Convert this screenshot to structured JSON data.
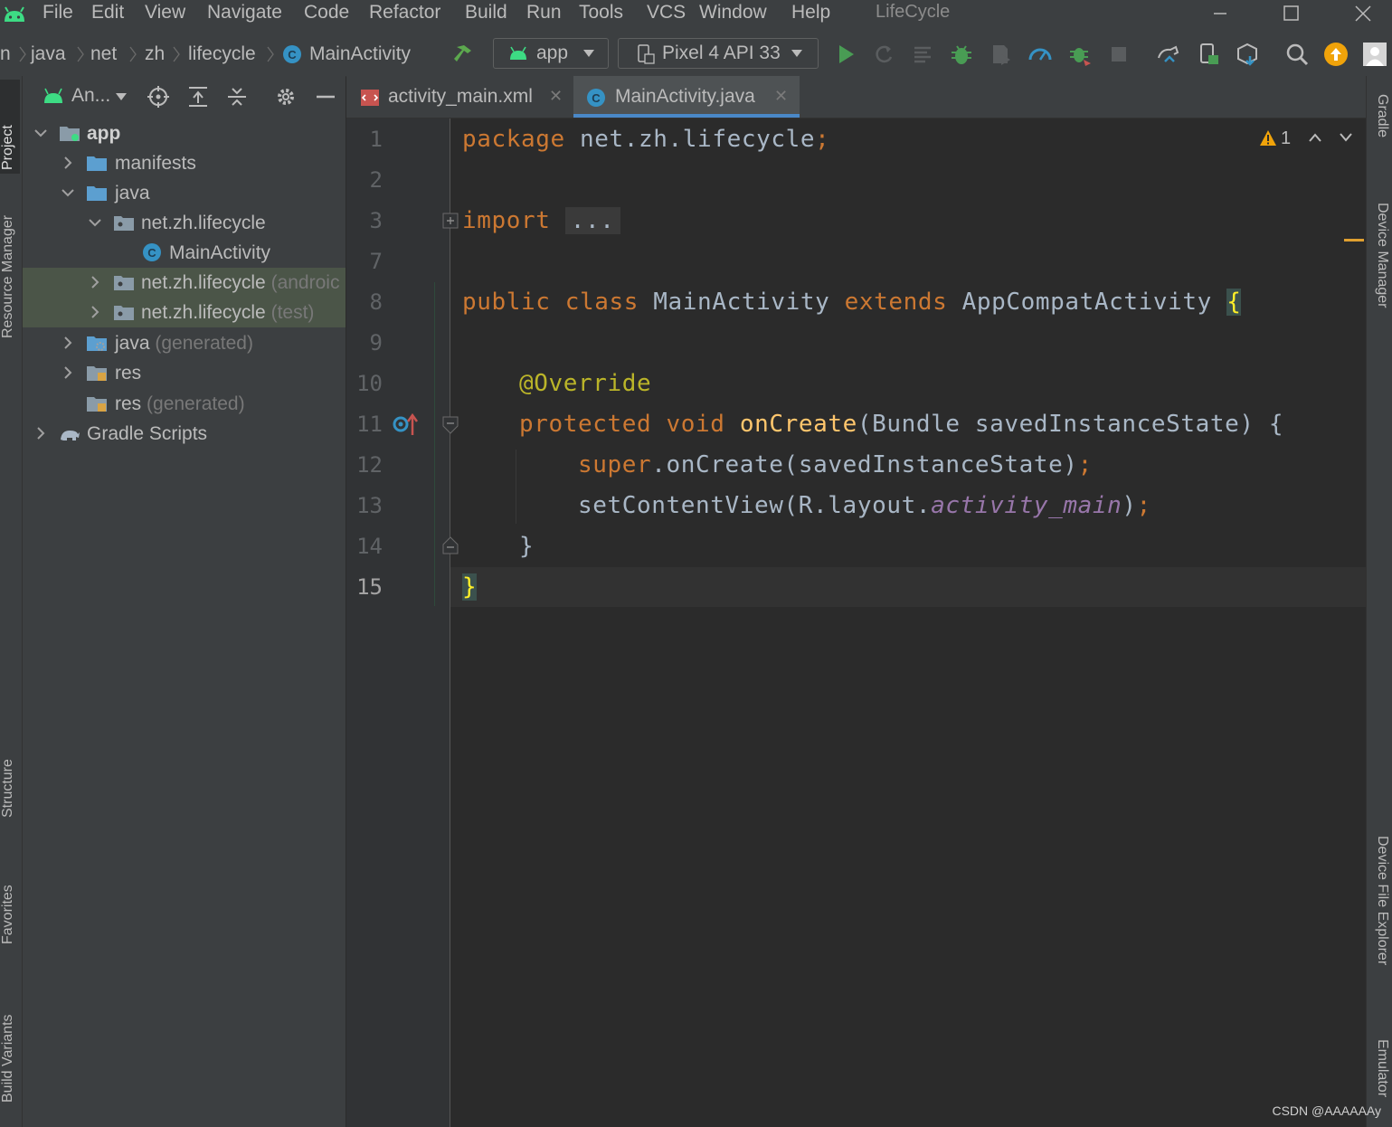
{
  "app": {
    "title": "LifeCycle",
    "menu": [
      "File",
      "Edit",
      "View",
      "Navigate",
      "Code",
      "Refactor",
      "Build",
      "Run",
      "Tools",
      "VCS",
      "Window",
      "Help"
    ]
  },
  "breadcrumbs": [
    "n",
    "java",
    "net",
    "zh",
    "lifecycle",
    "MainActivity"
  ],
  "toolbar": {
    "run_config": "app",
    "device": "Pixel 4 API 33"
  },
  "left_stripe": [
    "Project",
    "Resource Manager",
    "Structure",
    "Favorites",
    "Build Variants"
  ],
  "right_stripe": [
    "Gradle",
    "Device Manager",
    "Device File Explorer",
    "Emulator"
  ],
  "project_panel": {
    "view_selector": "An...",
    "tree": [
      {
        "label": "app",
        "suffix": ""
      },
      {
        "label": "manifests",
        "suffix": ""
      },
      {
        "label": "java",
        "suffix": ""
      },
      {
        "label": "net.zh.lifecycle",
        "suffix": ""
      },
      {
        "label": "MainActivity",
        "suffix": ""
      },
      {
        "label": "net.zh.lifecycle",
        "suffix": "(androic"
      },
      {
        "label": "net.zh.lifecycle",
        "suffix": "(test)"
      },
      {
        "label": "java",
        "suffix": "(generated)"
      },
      {
        "label": "res",
        "suffix": ""
      },
      {
        "label": "res",
        "suffix": "(generated)"
      },
      {
        "label": "Gradle Scripts",
        "suffix": ""
      }
    ]
  },
  "editor": {
    "tabs": [
      {
        "label": "activity_main.xml",
        "active": false
      },
      {
        "label": "MainActivity.java",
        "active": true
      }
    ],
    "warnings": "1",
    "line_numbers": [
      "1",
      "2",
      "3",
      "7",
      "8",
      "9",
      "10",
      "11",
      "12",
      "13",
      "14",
      "15"
    ],
    "code": {
      "l1_kw": "package",
      "l1_rest": " net.zh.lifecycle",
      "l1_semi": ";",
      "l3_kw": "import",
      "l3_fold": "...",
      "l8_kw1": "public class",
      "l8_name": " MainActivity ",
      "l8_kw2": "extends",
      "l8_parent": " AppCompatActivity ",
      "l8_brace": "{",
      "l10_ann": "@Override",
      "l11_kw": "protected void",
      "l11_fn": "onCreate",
      "l11_rest": "(Bundle savedInstanceState) {",
      "l12_kw": "super",
      "l12_rest": ".onCreate(savedInstanceState)",
      "l12_semi": ";",
      "l13_a": "setContentView(R.layout.",
      "l13_field": "activity_main",
      "l13_b": ")",
      "l13_semi": ";",
      "l14": "}",
      "l15_brace": "}"
    }
  },
  "watermark": "CSDN @AAAAAAy"
}
